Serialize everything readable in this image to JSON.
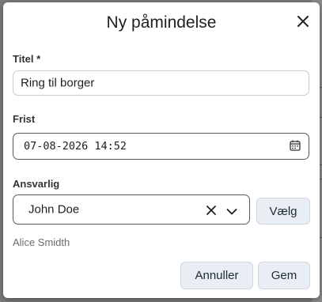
{
  "dialog": {
    "title": "Ny påmindelse",
    "close_icon": "close-icon"
  },
  "form": {
    "title_label": "Titel *",
    "title_value": "Ring til borger",
    "deadline_label": "Frist",
    "deadline_value": "07-08-2026 14:52",
    "deadline_icon": "calendar-icon",
    "responsible_label": "Ansvarlig",
    "responsible_value": "John Doe",
    "clear_icon": "clear-icon",
    "dropdown_icon": "chevron-down-icon",
    "choose_label": "Vælg",
    "helper_text": "Alice Smidth"
  },
  "actions": {
    "cancel_label": "Annuller",
    "save_label": "Gem"
  },
  "colors": {
    "backdrop": "#7a7a7a",
    "button_bg": "#e8eef4",
    "field_border": "#cccccc",
    "field_border_active": "#5a5a5a"
  }
}
